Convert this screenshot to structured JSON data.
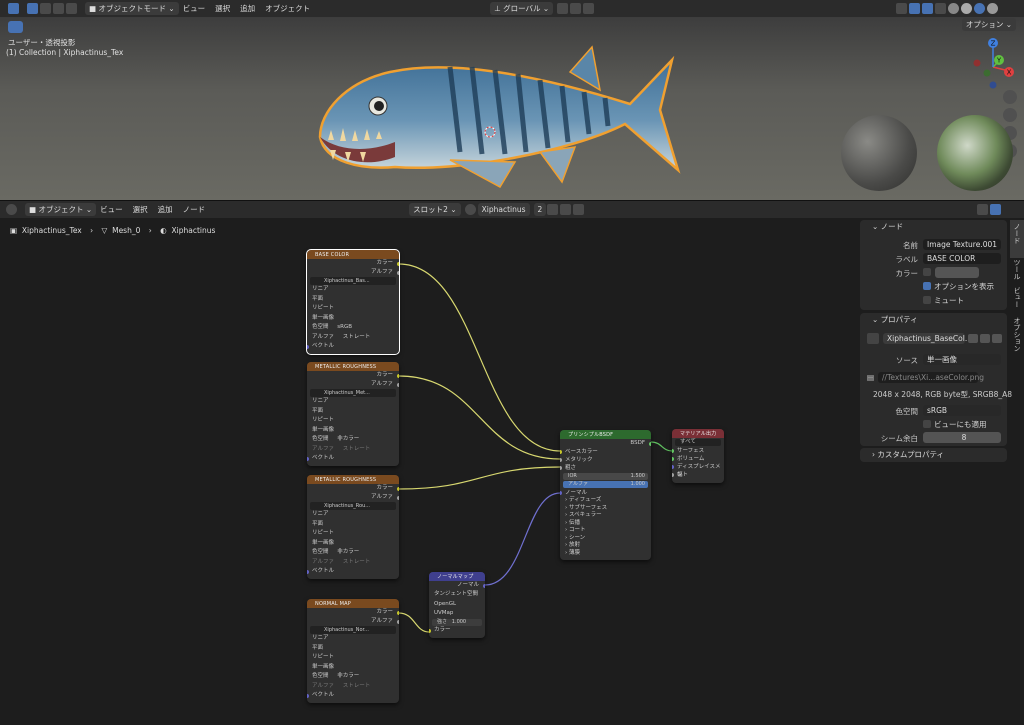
{
  "viewport_header": {
    "mode": "オブジェクトモード",
    "menus": [
      "ビュー",
      "選択",
      "追加",
      "オブジェクト"
    ],
    "transform_orientation": "グローバル",
    "options": "オプション"
  },
  "viewport": {
    "view_name": "ユーザー・透視投影",
    "object_path": "(1) Collection | Xiphactinus_Tex",
    "gizmo_axes": [
      "X",
      "Y",
      "Z"
    ]
  },
  "node_header": {
    "mode": "オブジェクト",
    "menus": [
      "ビュー",
      "選択",
      "追加",
      "ノード"
    ],
    "slot": "スロット2",
    "material": "Xiphactinus",
    "user_count": "2"
  },
  "breadcrumb": [
    "Xiphactinus_Tex",
    "Mesh_0",
    "Xiphactinus"
  ],
  "nodes": {
    "base_color": {
      "title": "BASE COLOR",
      "outputs": [
        "カラー",
        "アルファ"
      ],
      "image": "Xiphactinus_Bas...",
      "interpolation": "リニア",
      "projection": "平面",
      "extension": "リピート",
      "source": "単一画像",
      "colorspace_label": "色空間",
      "colorspace": "sRGB",
      "alpha_label": "アルファ",
      "alpha": "ストレート",
      "vector": "ベクトル"
    },
    "metallic1": {
      "title": "METALLIC ROUGHNESS",
      "outputs": [
        "カラー",
        "アルファ"
      ],
      "image": "Xiphactinus_Met...",
      "interpolation": "リニア",
      "projection": "平面",
      "extension": "リピート",
      "source": "単一画像",
      "colorspace_label": "色空間",
      "colorspace": "非カラー",
      "alpha_label": "アルファ",
      "alpha": "ストレート",
      "vector": "ベクトル"
    },
    "metallic2": {
      "title": "METALLIC ROUGHNESS",
      "outputs": [
        "カラー",
        "アルファ"
      ],
      "image": "Xiphactinus_Rou...",
      "interpolation": "リニア",
      "projection": "平面",
      "extension": "リピート",
      "source": "単一画像",
      "colorspace_label": "色空間",
      "colorspace": "非カラー",
      "alpha_label": "アルファ",
      "alpha": "ストレート",
      "vector": "ベクトル"
    },
    "normal_map_tex": {
      "title": "NORMAL MAP",
      "outputs": [
        "カラー",
        "アルファ"
      ],
      "image": "Xiphactinus_Nor...",
      "interpolation": "リニア",
      "projection": "平面",
      "extension": "リピート",
      "source": "単一画像",
      "colorspace_label": "色空間",
      "colorspace": "非カラー",
      "alpha_label": "アルファ",
      "alpha": "ストレート",
      "vector": "ベクトル"
    },
    "normal_map": {
      "title": "ノーマルマップ",
      "output": "ノーマル",
      "space": "タンジェント空間",
      "convention": "OpenGL",
      "uvmap": "UVMap",
      "strength_label": "強さ",
      "strength": "1.000",
      "color": "カラー"
    },
    "bsdf": {
      "title": "プリンシプルBSDF",
      "output": "BSDF",
      "inputs": [
        "ベースカラー",
        "メタリック",
        "粗さ"
      ],
      "ior_label": "IOR",
      "ior": "1.500",
      "alpha_label": "アルファ",
      "alpha": "1.000",
      "normal": "ノーマル",
      "panels": [
        "ディフューズ",
        "サブサーフェス",
        "スペキュラー",
        "伝播",
        "コート",
        "シーン",
        "放射",
        "薄膜"
      ]
    },
    "material_output": {
      "title": "マテリアル出力",
      "target": "すべて",
      "inputs": [
        "サーフェス",
        "ボリューム",
        "ディスプレイスメント",
        "幅"
      ]
    }
  },
  "sidebar": {
    "node_panel": {
      "title": "ノード",
      "name_label": "名前",
      "name": "Image Texture.001",
      "label_label": "ラベル",
      "label": "BASE COLOR",
      "color_label": "カラー",
      "show_options": "オプションを表示",
      "mute": "ミュート"
    },
    "properties_panel": {
      "title": "プロパティ",
      "image": "Xiphactinus_BaseCol...",
      "source_label": "ソース",
      "source": "単一画像",
      "filepath": "//Textures\\Xi...aseColor.png",
      "info": "2048 x 2048,  RGB byte型, SRGB8_A8",
      "colorspace_label": "色空間",
      "colorspace": "sRGB",
      "view_as_render": "ビューにも適用",
      "seam_label": "シーム余白",
      "seam": "8"
    },
    "custom_props": "カスタムプロパティ",
    "tabs": [
      "ノード",
      "ツール",
      "ビュー",
      "オプション"
    ]
  }
}
